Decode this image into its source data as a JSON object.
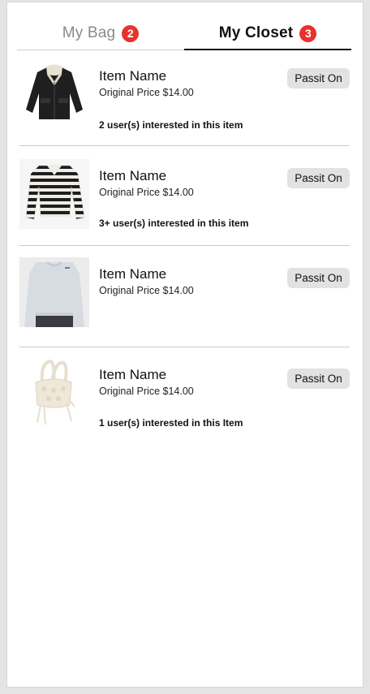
{
  "tabs": [
    {
      "label": "My Bag",
      "badge": "2",
      "active": false
    },
    {
      "label": "My Closet",
      "badge": "3",
      "active": true
    }
  ],
  "items": [
    {
      "name": "Item Name",
      "price": "Original Price $14.00",
      "interest": "2 user(s) interested in this item",
      "button": "Passit On",
      "image": "black-jacket-image"
    },
    {
      "name": "Item Name",
      "price": "Original Price $14.00",
      "interest": "3+ user(s) interested in this item",
      "button": "Passit On",
      "image": "striped-sweater-image"
    },
    {
      "name": "Item Name",
      "price": "Original Price $14.00",
      "interest": "",
      "button": "Passit On",
      "image": "grey-sweatshirt-image"
    },
    {
      "name": "Item Name",
      "price": "Original Price $14.00",
      "interest": "1 user(s) interested in this Item",
      "button": "Passit On",
      "image": "knit-bag-image"
    }
  ],
  "colors": {
    "badge": "#e8322d",
    "button_bg": "#e2e2e2",
    "active_tab": "#111111",
    "inactive_tab": "#8a8a8a"
  }
}
